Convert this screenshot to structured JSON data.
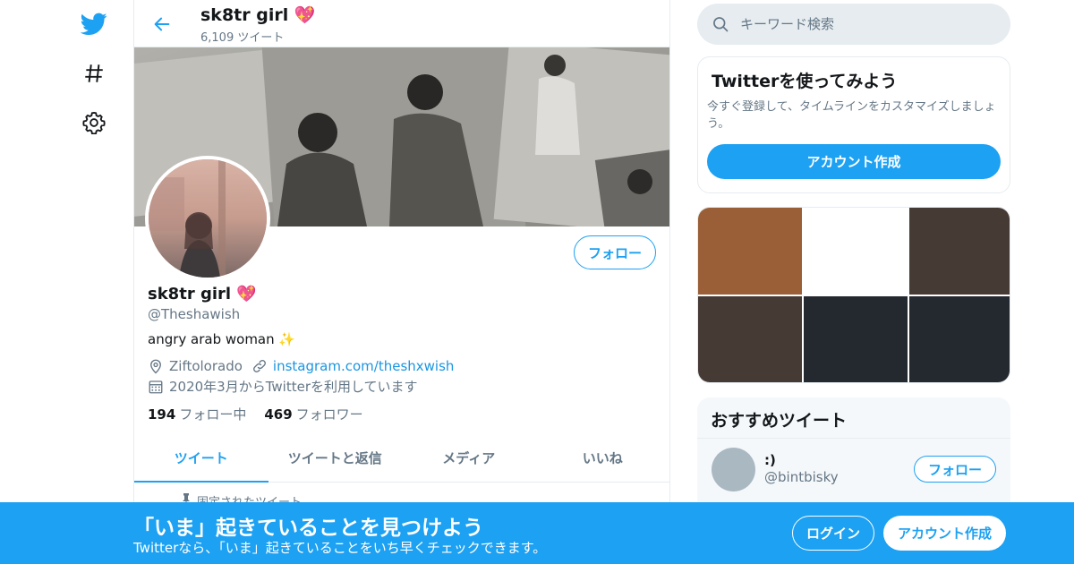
{
  "nav": {
    "icons": [
      "twitter-logo-icon",
      "hashtag-icon",
      "gear-icon"
    ]
  },
  "header": {
    "name": "sk8tr girl",
    "name_emoji": "💖",
    "tweet_count": "6,109 ツイート"
  },
  "profile": {
    "name": "sk8tr girl",
    "name_emoji": "💖",
    "handle": "@Theshawish",
    "bio": "angry arab woman",
    "bio_emoji": "✨",
    "location": "Ziftolorado",
    "website": "instagram.com/theshxwish",
    "joined": "2020年3月からTwitterを利用しています",
    "following_count": "194",
    "following_label": "フォロー中",
    "followers_count": "469",
    "followers_label": "フォロワー",
    "follow_button": "フォロー"
  },
  "tabs": [
    {
      "label": "ツイート",
      "active": true
    },
    {
      "label": "ツイートと返信",
      "active": false
    },
    {
      "label": "メディア",
      "active": false
    },
    {
      "label": "いいね",
      "active": false
    }
  ],
  "pinned_label": "固定されたツイート",
  "search": {
    "placeholder": "キーワード検索"
  },
  "signup_card": {
    "title": "Twitterを使ってみよう",
    "subtitle": "今すぐ登録して、タイムラインをカスタマイズしましょう。",
    "button": "アカウント作成"
  },
  "media_grid": {
    "colors": [
      "#9a5f37",
      "#ffffff",
      "#463a35",
      "#463a35",
      "#24292f",
      "#24292f"
    ]
  },
  "recommended": {
    "title": "おすすめツイート",
    "user_name": ":)",
    "user_handle": "@bintbisky",
    "follow_button": "フォロー"
  },
  "bottom_bar": {
    "title": "「いま」起きていることを見つけよう",
    "subtitle": "Twitterなら、「いま」起きていることをいち早くチェックできます。",
    "login": "ログイン",
    "signup": "アカウント作成"
  },
  "colors": {
    "accent": "#1da1f2",
    "text_secondary": "#657786",
    "border": "#e6ecf0"
  }
}
